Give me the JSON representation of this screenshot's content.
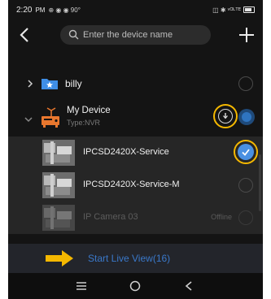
{
  "status_bar": {
    "time": "2:20",
    "meridiem": "PM",
    "notification_icons": "⊕ ◉ ◉ 90°",
    "right_icons": "◫ ✱ ᵛᴼᴸᵀᴱ"
  },
  "header": {
    "search_placeholder": "Enter the device name",
    "back_icon": "chevron-left-icon",
    "add_icon": "plus-icon"
  },
  "tree": {
    "groups": [
      {
        "label": "billy",
        "expanded": false,
        "icon": "folder-star-icon"
      },
      {
        "label": "My Device",
        "sublabel": "Type:NVR",
        "expanded": true,
        "icon": "nvr-device-icon"
      }
    ],
    "cameras": [
      {
        "label": "IPCSD2420X-Service",
        "selected": true,
        "status": ""
      },
      {
        "label": "IPCSD2420X-Service-M",
        "selected": false,
        "status": ""
      },
      {
        "label": "IP Camera 03",
        "selected": false,
        "status": "Offline"
      }
    ]
  },
  "action": {
    "live_view_label": "Start Live View(16)"
  },
  "colors": {
    "highlight_ring": "#f5b800",
    "accent_blue": "#3a78c9",
    "background": "#141414"
  }
}
